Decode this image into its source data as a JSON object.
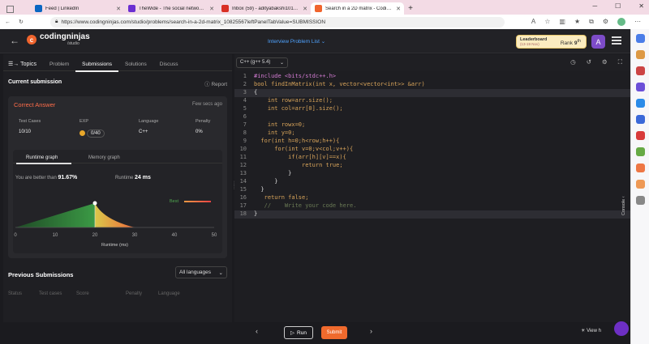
{
  "browser": {
    "tabs": [
      {
        "title": "Feed | LinkedIn",
        "color": "#0a66c2"
      },
      {
        "title": "TheWide - The social network b...",
        "color": "#6b2fd1"
      },
      {
        "title": "Inbox (59) - adityabakshi1011@...",
        "color": "#d93025"
      },
      {
        "title": "Search in a 2D matrix - Coding N...",
        "color": "#f0642d"
      }
    ],
    "new_tab": "+",
    "url": "https://www.codingninjas.com/studio/problems/search-in-a-2d-matrix_10825567leftPanelTabValue=SUBMISSION"
  },
  "header": {
    "brand": "codingninjas",
    "brand_sub": "/studio",
    "problem_list": "Interview Problem List",
    "leaderboard_label": "Leaderboard",
    "leaderboard_dates": "(13-19 Nov)",
    "rank_label": "Rank",
    "rank_value": "9",
    "rank_suffix": "th",
    "avatar_letter": "A"
  },
  "left": {
    "topics": "Topics",
    "tabs": [
      "Problem",
      "Submissions",
      "Solutions",
      "Discuss"
    ],
    "active_tab": "Submissions",
    "current_submission": "Current submission",
    "report": "Report",
    "result": "Correct Answer",
    "time_ago": "Few secs ago",
    "stats": [
      {
        "label": "Test Cases",
        "value": "10/10"
      },
      {
        "label": "EXP",
        "value": "0/40"
      },
      {
        "label": "Language",
        "value": "C++"
      },
      {
        "label": "Penalty",
        "value": "0%"
      }
    ],
    "graph_tabs": [
      "Runtime graph",
      "Memory graph"
    ],
    "better_text": "You are better than",
    "better_value": "91.67%",
    "runtime_label": "Runtime",
    "runtime_value": "24 ms",
    "best_label": "Best",
    "previous_submissions": "Previous Submissions",
    "lang_filter": "All languages",
    "columns": [
      "Status",
      "Test cases",
      "Score",
      "Penalty",
      "Language"
    ]
  },
  "chart_data": {
    "type": "area",
    "xlabel": "Runtime (ms)",
    "xticks": [
      0,
      10,
      20,
      30,
      40,
      50
    ],
    "xlim": [
      0,
      50
    ],
    "x": [
      0,
      20,
      30
    ],
    "y": [
      0,
      1,
      0
    ],
    "marker": {
      "x": 20,
      "label": "Best"
    },
    "colors": {
      "left": "#2f8a3a",
      "right": "#e8842a"
    }
  },
  "editor": {
    "language": "C++ (g++ 5.4)",
    "lines": [
      "#include <bits/stdc++.h>",
      "bool findInMatrix(int x, vector<vector<int>> &arr)",
      "{",
      "    int row=arr.size();",
      "    int col=arr[0].size();",
      "",
      "    int rowx=0;",
      "    int y=0;",
      "  for(int h=0;h<row;h++){",
      "      for(int v=0;v<col;v++){",
      "          if(arr[h][v]==x){",
      "              return true;",
      "          }",
      "      }",
      "  }",
      "   return false;",
      "   //    Write your code here.",
      "}"
    ],
    "console_label": "Console"
  },
  "footer": {
    "run": "Run",
    "submit": "Submit",
    "view": "View h"
  }
}
